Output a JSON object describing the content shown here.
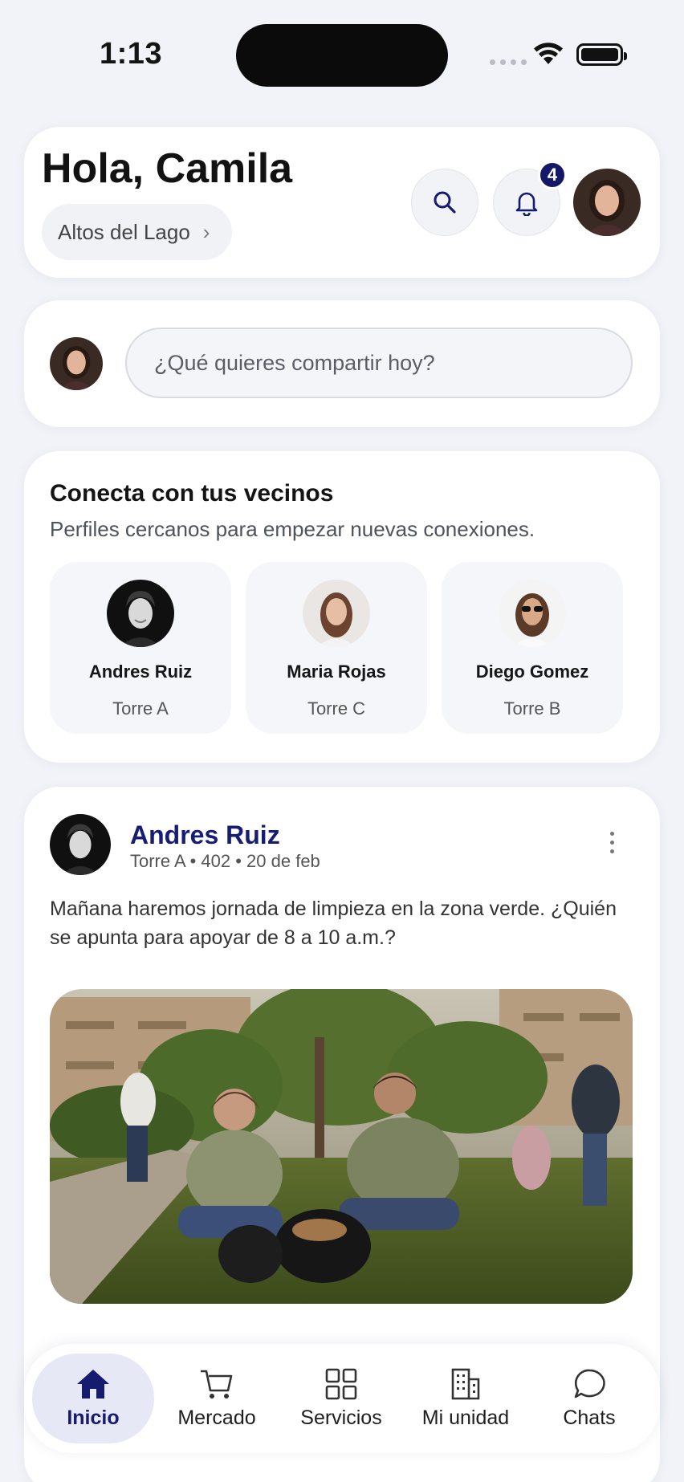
{
  "status_bar": {
    "time": "1:13"
  },
  "header": {
    "greeting": "Hola, Camila",
    "community": "Altos del Lago",
    "notification_count": "4"
  },
  "composer": {
    "placeholder": "¿Qué quieres compartir hoy?"
  },
  "neighbors": {
    "title": "Conecta con tus vecinos",
    "subtitle": "Perfiles cercanos para empezar nuevas conexiones.",
    "items": [
      {
        "name": "Andres Ruiz",
        "tower": "Torre A"
      },
      {
        "name": "Maria Rojas",
        "tower": "Torre C"
      },
      {
        "name": "Diego Gomez",
        "tower": "Torre B"
      }
    ]
  },
  "post": {
    "author": "Andres Ruiz",
    "meta": "Torre A • 402 • 20 de feb",
    "text": "Mañana haremos jornada de limpieza en la zona verde. ¿Quién se apunta para apoyar de 8 a 10 a.m.?"
  },
  "nav": {
    "items": [
      {
        "label": "Inicio",
        "icon": "home-icon",
        "active": true
      },
      {
        "label": "Mercado",
        "icon": "cart-icon"
      },
      {
        "label": "Servicios",
        "icon": "grid-icon"
      },
      {
        "label": "Mi unidad",
        "icon": "building-icon"
      },
      {
        "label": "Chats",
        "icon": "chat-bubble-icon"
      }
    ]
  },
  "colors": {
    "accent": "#181d74",
    "background": "#f1f3f8"
  }
}
